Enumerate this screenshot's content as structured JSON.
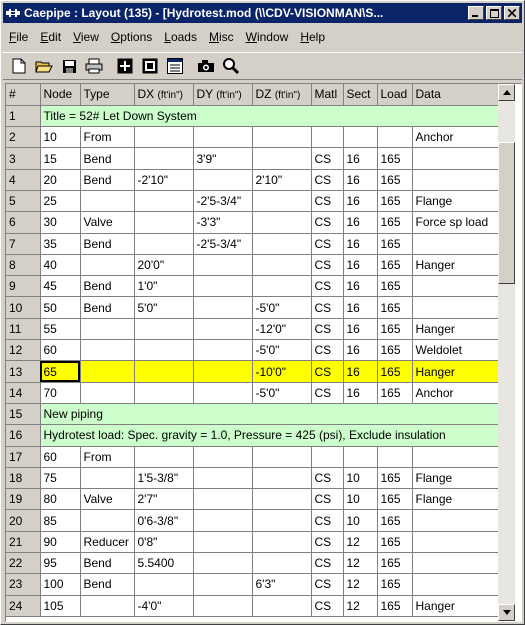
{
  "window": {
    "title": "Caepipe : Layout  (135)  - [Hydrotest.mod (\\\\CDV-VISIONMAN\\S..."
  },
  "menu": [
    {
      "u": "F",
      "rest": "ile"
    },
    {
      "u": "E",
      "rest": "dit"
    },
    {
      "u": "V",
      "rest": "iew"
    },
    {
      "u": "O",
      "rest": "ptions"
    },
    {
      "u": "L",
      "rest": "oads"
    },
    {
      "u": "M",
      "rest": "isc"
    },
    {
      "u": "W",
      "rest": "indow"
    },
    {
      "u": "H",
      "rest": "elp"
    }
  ],
  "toolbar_icons": [
    "new-file-icon",
    "open-folder-icon",
    "save-icon",
    "print-icon",
    "grid-view-icon",
    "graphics-view-icon",
    "list-view-icon",
    "camera-icon",
    "zoom-icon"
  ],
  "columns": [
    {
      "label": "#"
    },
    {
      "label": "Node"
    },
    {
      "label": "Type"
    },
    {
      "label": "DX",
      "unit": "(ft'in\")"
    },
    {
      "label": "DY",
      "unit": "(ft'in\")"
    },
    {
      "label": "DZ",
      "unit": "(ft'in\")"
    },
    {
      "label": "Matl"
    },
    {
      "label": "Sect"
    },
    {
      "label": "Load"
    },
    {
      "label": "Data"
    }
  ],
  "rows": [
    {
      "n": "1",
      "span": "Title = 52# Let Down System"
    },
    {
      "n": "2",
      "cells": [
        "10",
        "From",
        "",
        "",
        "",
        "",
        "",
        "",
        "Anchor"
      ]
    },
    {
      "n": "3",
      "cells": [
        "15",
        "Bend",
        "",
        "3'9\"",
        "",
        "CS",
        "16",
        "165",
        ""
      ]
    },
    {
      "n": "4",
      "cells": [
        "20",
        "Bend",
        "-2'10\"",
        "",
        "2'10\"",
        "CS",
        "16",
        "165",
        ""
      ]
    },
    {
      "n": "5",
      "cells": [
        "25",
        "",
        "",
        "-2'5-3/4\"",
        "",
        "CS",
        "16",
        "165",
        "Flange"
      ]
    },
    {
      "n": "6",
      "cells": [
        "30",
        "Valve",
        "",
        "-3'3\"",
        "",
        "CS",
        "16",
        "165",
        "Force sp load"
      ]
    },
    {
      "n": "7",
      "cells": [
        "35",
        "Bend",
        "",
        "-2'5-3/4\"",
        "",
        "CS",
        "16",
        "165",
        ""
      ]
    },
    {
      "n": "8",
      "cells": [
        "40",
        "",
        "20'0\"",
        "",
        "",
        "CS",
        "16",
        "165",
        "Hanger"
      ]
    },
    {
      "n": "9",
      "cells": [
        "45",
        "Bend",
        "1'0\"",
        "",
        "",
        "CS",
        "16",
        "165",
        ""
      ]
    },
    {
      "n": "10",
      "cells": [
        "50",
        "Bend",
        "5'0\"",
        "",
        "-5'0\"",
        "CS",
        "16",
        "165",
        ""
      ]
    },
    {
      "n": "11",
      "cells": [
        "55",
        "",
        "",
        "",
        "-12'0\"",
        "CS",
        "16",
        "165",
        "Hanger"
      ]
    },
    {
      "n": "12",
      "cells": [
        "60",
        "",
        "",
        "",
        "-5'0\"",
        "CS",
        "16",
        "165",
        "Weldolet"
      ]
    },
    {
      "n": "13",
      "cells": [
        "65",
        "",
        "",
        "",
        "-10'0\"",
        "CS",
        "16",
        "165",
        "Hanger"
      ],
      "highlight": true
    },
    {
      "n": "14",
      "cells": [
        "70",
        "",
        "",
        "",
        "-5'0\"",
        "CS",
        "16",
        "165",
        "Anchor"
      ]
    },
    {
      "n": "15",
      "span": "New piping"
    },
    {
      "n": "16",
      "span": "Hydrotest load: Spec. gravity = 1.0,  Pressure =  425 (psi),  Exclude insulation"
    },
    {
      "n": "17",
      "cells": [
        "60",
        "From",
        "",
        "",
        "",
        "",
        "",
        "",
        ""
      ]
    },
    {
      "n": "18",
      "cells": [
        "75",
        "",
        "1'5-3/8\"",
        "",
        "",
        "CS",
        "10",
        "165",
        "Flange"
      ]
    },
    {
      "n": "19",
      "cells": [
        "80",
        "Valve",
        "2'7\"",
        "",
        "",
        "CS",
        "10",
        "165",
        "Flange"
      ]
    },
    {
      "n": "20",
      "cells": [
        "85",
        "",
        "0'6-3/8\"",
        "",
        "",
        "CS",
        "10",
        "165",
        ""
      ]
    },
    {
      "n": "21",
      "cells": [
        "90",
        "Reducer",
        "0'8\"",
        "",
        "",
        "CS",
        "12",
        "165",
        ""
      ]
    },
    {
      "n": "22",
      "cells": [
        "95",
        "Bend",
        "5.5400",
        "",
        "",
        "CS",
        "12",
        "165",
        ""
      ]
    },
    {
      "n": "23",
      "cells": [
        "100",
        "Bend",
        "",
        "",
        "6'3\"",
        "CS",
        "12",
        "165",
        ""
      ]
    },
    {
      "n": "24",
      "cells": [
        "105",
        "",
        "-4'0\"",
        "",
        "",
        "CS",
        "12",
        "165",
        "Hanger"
      ]
    }
  ]
}
